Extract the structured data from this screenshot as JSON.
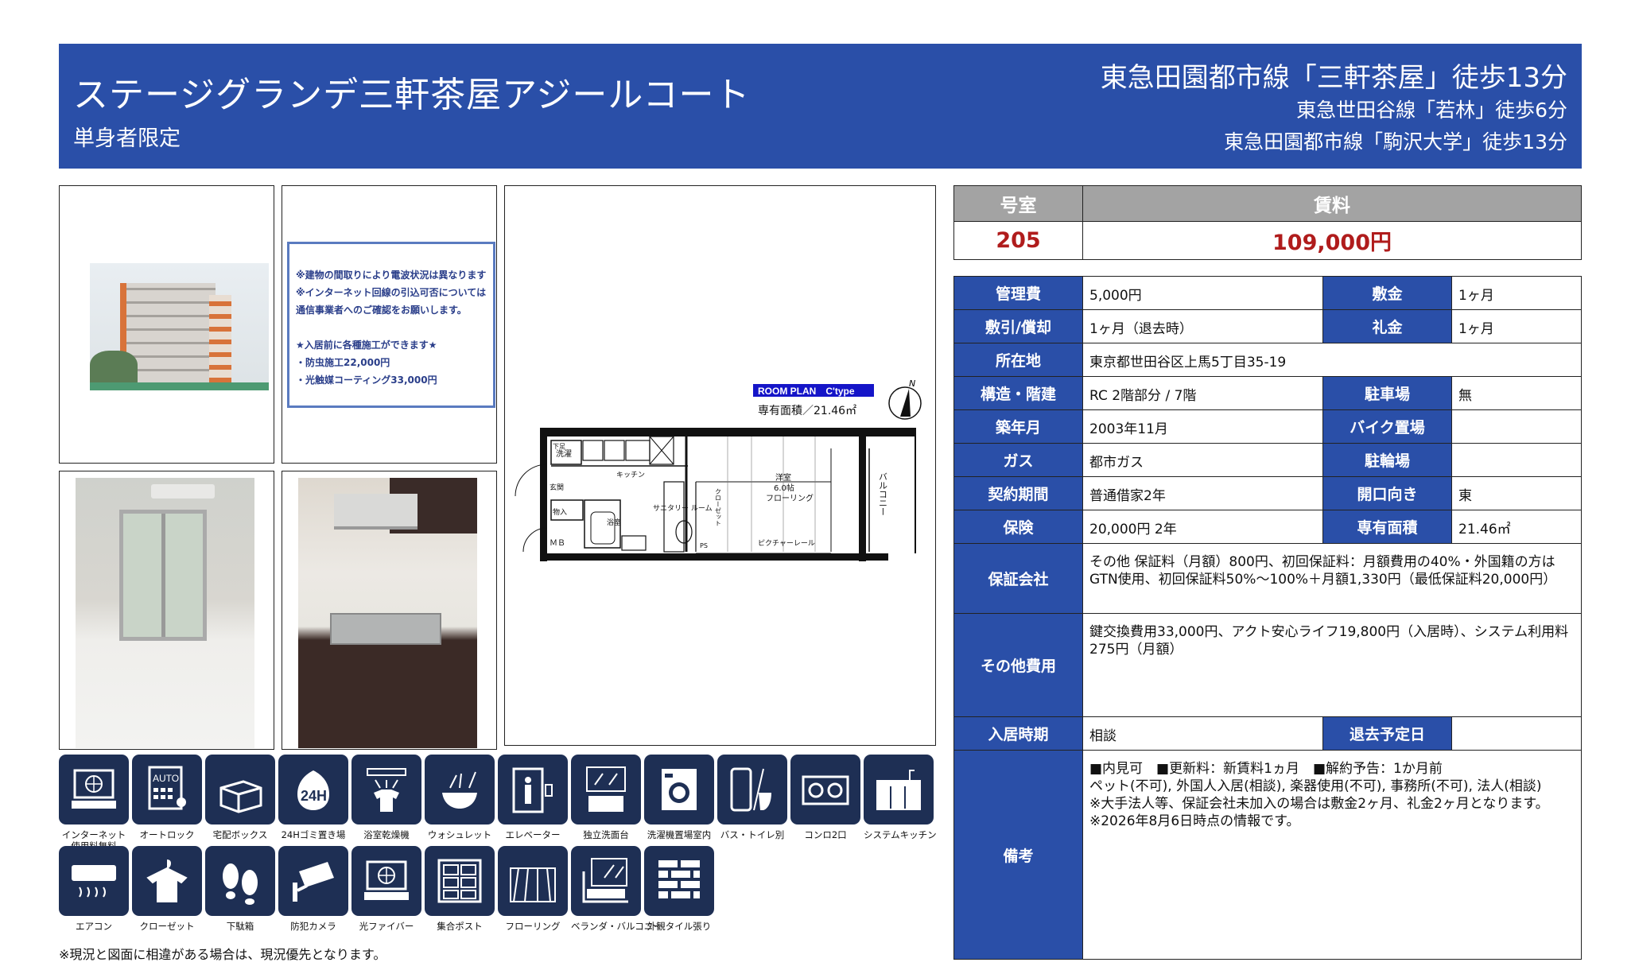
{
  "header": {
    "property_name": "ステージグランデ三軒茶屋アジールコート",
    "subtitle": "単身者限定",
    "station_main": "東急田園都市線「三軒茶屋」徒歩13分",
    "station_2": "東急世田谷線「若林」徒歩6分",
    "station_3": "東急田園都市線「駒沢大学」徒歩13分"
  },
  "notice": {
    "lines": [
      "※建物の間取りにより電波状況は異なります",
      "※インターネット回線の引込可否については",
      "通信事業者へのご確認をお願いします。",
      "",
      "★入居前に各種施工ができます★",
      "・防虫施工22,000円",
      "・光触媒コーティング33,000円"
    ]
  },
  "floorplan": {
    "plan_label": "ROOM PLAN　C'type",
    "area_label": "専有面積／21.46㎡",
    "north": "N",
    "rooms": {
      "washer": "洗濯",
      "kitchen": "キッチン",
      "entrance": "玄関",
      "storage": "物入",
      "bath": "浴室",
      "sanitary": "サニタリー\nルーム",
      "closet": "クローゼット",
      "western": "洋室",
      "size": "6.0帖",
      "flooring": "フローリング",
      "balcony": "バルコニー",
      "rail": "ピクチャーレール",
      "mb": "ＭＢ",
      "ps": "PS",
      "shoe": "下足"
    }
  },
  "price": {
    "room_label": "号室",
    "rent_label": "賃料",
    "room": "205",
    "rent": "109,000円"
  },
  "details": {
    "kanrihi_label": "管理費",
    "kanrihi": "5,000円",
    "shikikin_label": "敷金",
    "shikikin": "1ヶ月",
    "shikibiki_label": "敷引/償却",
    "shikibiki": "1ヶ月（退去時）",
    "reikin_label": "礼金",
    "reikin": "1ヶ月",
    "address_label": "所在地",
    "address": "東京都世田谷区上馬5丁目35-19",
    "structure_label": "構造・階建",
    "structure": "RC 2階部分 / 7階",
    "parking_label": "駐車場",
    "parking": "無",
    "built_label": "築年月",
    "built": "2003年11月",
    "bike_label": "バイク置場",
    "bike": "",
    "gas_label": "ガス",
    "gas": "都市ガス",
    "bicycle_label": "駐輪場",
    "bicycle": "",
    "contract_label": "契約期間",
    "contract": "普通借家2年",
    "direction_label": "開口向き",
    "direction": "東",
    "insurance_label": "保険",
    "insurance": "20,000円 2年",
    "area_label": "専有面積",
    "area": "21.46㎡",
    "guarantor_label": "保証会社",
    "guarantor_1": "その他 保証料（月額）800円、初回保証料：月額費用の40%・外国籍の方は",
    "guarantor_2": "GTN使用、初回保証料50%～100%＋月額1,330円（最低保証料20,000円）",
    "other_label": "その他費用",
    "other_1": "鍵交換費用33,000円、アクト安心ライフ19,800円（入居時）、システム利用料",
    "other_2": "275円（月額）",
    "movein_label": "入居時期",
    "movein": "相談",
    "moveout_label": "退去予定日",
    "moveout": "",
    "remarks_label": "備考",
    "remarks_1": "■内見可　■更新料：新賃料1ヵ月　■解約予告：1か月前",
    "remarks_2": "ペット(不可), 外国人入居(相談), 楽器使用(不可), 事務所(不可), 法人(相談)",
    "remarks_3": "※大手法人等、保証会社未加入の場合は敷金2ヶ月、礼金2ヶ月となります。",
    "remarks_4": "※2026年8月6日時点の情報です。"
  },
  "amenities": {
    "row1": [
      {
        "label": "インターネット\n使用料無料",
        "icon": "internet-icon"
      },
      {
        "label": "オートロック",
        "icon": "autolock-icon"
      },
      {
        "label": "宅配ボックス",
        "icon": "delivery-box-icon"
      },
      {
        "label": "24Hゴミ置き場",
        "icon": "garbage-24h-icon"
      },
      {
        "label": "浴室乾燥機",
        "icon": "bath-dryer-icon"
      },
      {
        "label": "ウォシュレット",
        "icon": "washlet-icon"
      },
      {
        "label": "エレベーター",
        "icon": "elevator-icon"
      },
      {
        "label": "独立洗面台",
        "icon": "vanity-icon"
      },
      {
        "label": "洗濯機置場室内",
        "icon": "washing-machine-icon"
      },
      {
        "label": "バス・トイレ別",
        "icon": "bath-toilet-icon"
      },
      {
        "label": "コンロ2口",
        "icon": "stove-icon"
      },
      {
        "label": "システムキッチン",
        "icon": "kitchen-icon"
      }
    ],
    "row2": [
      {
        "label": "エアコン",
        "icon": "air-conditioner-icon"
      },
      {
        "label": "クローゼット",
        "icon": "closet-icon"
      },
      {
        "label": "下駄箱",
        "icon": "shoe-box-icon"
      },
      {
        "label": "防犯カメラ",
        "icon": "camera-icon"
      },
      {
        "label": "光ファイバー",
        "icon": "fiber-icon"
      },
      {
        "label": "集合ポスト",
        "icon": "mailbox-icon"
      },
      {
        "label": "フローリング",
        "icon": "flooring-icon"
      },
      {
        "label": "ベランダ・バルコニー",
        "icon": "balcony-icon"
      },
      {
        "label": "外観タイル張り",
        "icon": "tile-icon"
      }
    ]
  },
  "footer": "※現況と図面に相違がある場合は、現況優先となります。"
}
